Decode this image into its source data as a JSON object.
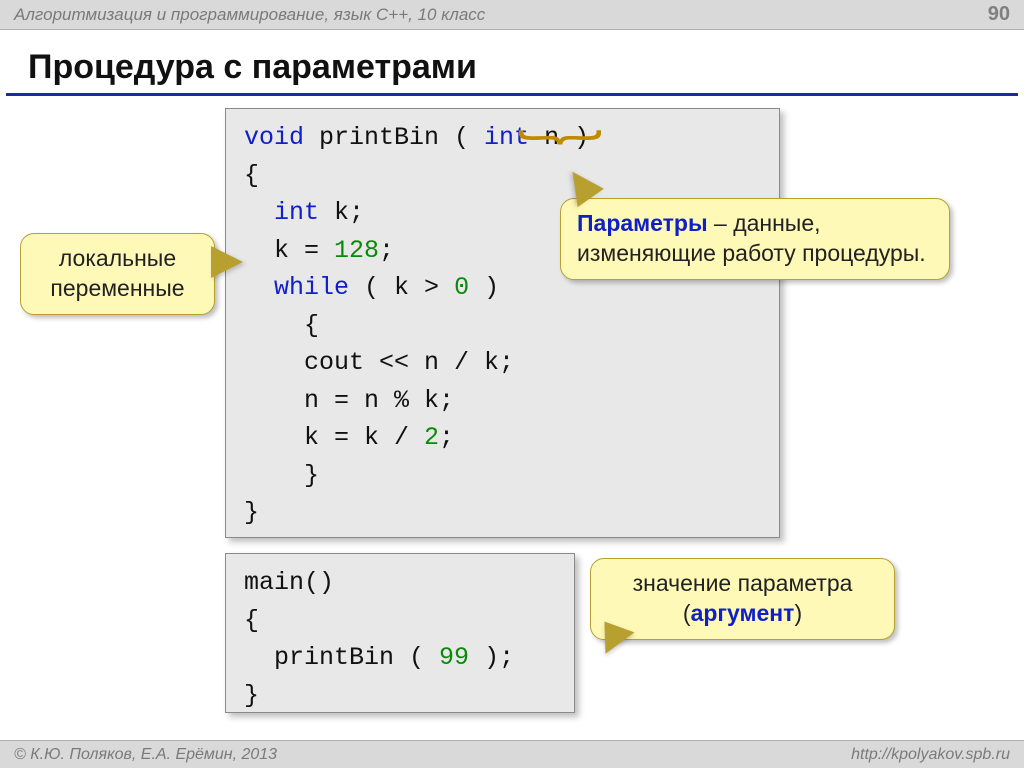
{
  "header": {
    "breadcrumb": "Алгоритмизация и программирование, язык  C++, 10 класс",
    "page": "90"
  },
  "title": "Процедура с параметрами",
  "code1": {
    "l1a": "void",
    "l1b": " printBin ( ",
    "l1c": "int",
    "l1d": " n )",
    "l2": "{",
    "l3a": "  int",
    "l3b": " k;",
    "l4a": "  k = ",
    "l4b": "128",
    "l4c": ";",
    "l5a": "  while",
    "l5b": " ( k > ",
    "l5c": "0",
    "l5d": " )",
    "l6": "    {",
    "l7": "    cout << n / k;",
    "l8": "    n = n % k;",
    "l9a": "    k = k / ",
    "l9b": "2",
    "l9c": ";",
    "l10": "    }",
    "l11": "}"
  },
  "code2": {
    "l1": "main()",
    "l2": "{",
    "l3a": "  printBin ( ",
    "l3b": "99",
    "l3c": " );",
    "l4": "}"
  },
  "callout_left": {
    "line1": "локальные",
    "line2": "переменные"
  },
  "callout_right": {
    "term": "Параметры",
    "rest": " – данные, изменяющие работу процедуры."
  },
  "callout_bottom": {
    "line1": "значение параметра",
    "open": "(",
    "arg": "аргумент",
    "close": ")"
  },
  "footer": {
    "left": "© К.Ю. Поляков, Е.А. Ерёмин, 2013",
    "right": "http://kpolyakov.spb.ru"
  }
}
